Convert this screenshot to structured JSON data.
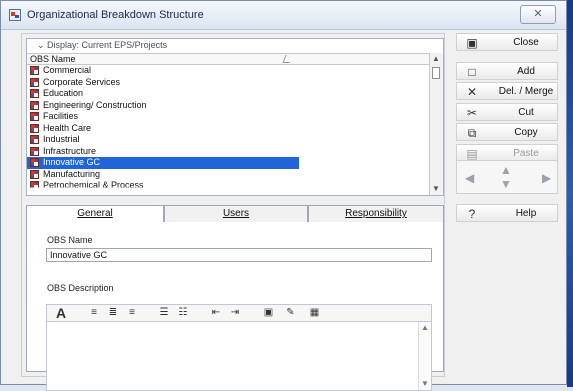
{
  "window": {
    "title": "Organizational Breakdown Structure",
    "close_symbol": "✕"
  },
  "filter": {
    "label": "Display: Current EPS/Projects"
  },
  "table": {
    "column_header": "OBS Name",
    "rows": [
      "Commercial",
      "Corporate Services",
      "Education",
      "Engineering/ Construction",
      "Facilities",
      "Health Care",
      "Industrial",
      "Infrastructure",
      "Innovative GC",
      "Manufacturing",
      "Petrochemical & Process"
    ],
    "selected": "Innovative GC"
  },
  "tabs": [
    {
      "label": "General",
      "underline": "G"
    },
    {
      "label": "Users",
      "underline": "U"
    },
    {
      "label": "Responsibility",
      "underline": "R"
    }
  ],
  "form": {
    "obs_name_label": "OBS Name",
    "obs_name_value": "Innovative GC",
    "obs_desc_label": "OBS Description"
  },
  "side_buttons": [
    {
      "label": "Close",
      "icon": "close-icon"
    },
    {
      "label": "Add",
      "icon": "add-icon"
    },
    {
      "label": "Del. / Merge",
      "icon": "delete-icon"
    },
    {
      "label": "Cut",
      "icon": "cut-icon"
    },
    {
      "label": "Copy",
      "icon": "copy-icon"
    },
    {
      "label": "Paste",
      "icon": "paste-icon"
    },
    {
      "label": "Help",
      "icon": "help-icon"
    }
  ],
  "colors": {
    "selection": "#1f64d8",
    "window_bg": "#f0f0f0",
    "border": "#9da9ba"
  }
}
